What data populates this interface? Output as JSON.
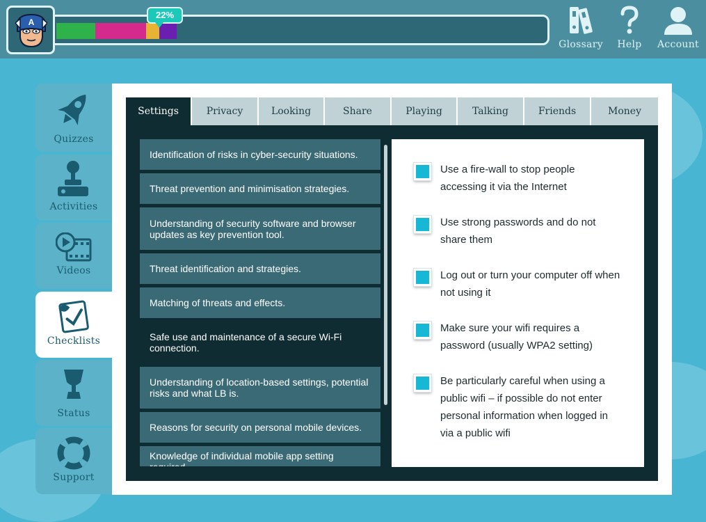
{
  "progress": {
    "percent_label": "22%",
    "value": 22,
    "segments": [
      {
        "color": "#2fb24a",
        "fraction": 0.079
      },
      {
        "color": "#d42a8b",
        "fraction": 0.103
      },
      {
        "color": "#e8b333",
        "fraction": 0.027
      },
      {
        "color": "#6a1fb0",
        "fraction": 0.036
      }
    ]
  },
  "avatar": {
    "icon": "captain-america-avatar"
  },
  "top_nav": [
    {
      "label": "Glossary",
      "icon": "books-icon"
    },
    {
      "label": "Help",
      "icon": "question-icon"
    },
    {
      "label": "Account",
      "icon": "user-icon"
    }
  ],
  "sidebar": {
    "items": [
      {
        "label": "Quizzes",
        "icon": "rocket-icon"
      },
      {
        "label": "Activities",
        "icon": "joystick-icon"
      },
      {
        "label": "Videos",
        "icon": "video-icon"
      },
      {
        "label": "Checklists",
        "icon": "checklist-icon",
        "active": true
      },
      {
        "label": "Status",
        "icon": "trophy-icon"
      },
      {
        "label": "Support",
        "icon": "lifebuoy-icon"
      }
    ]
  },
  "tabs": [
    {
      "label": "Settings",
      "active": true
    },
    {
      "label": "Privacy"
    },
    {
      "label": "Looking"
    },
    {
      "label": "Share"
    },
    {
      "label": "Playing"
    },
    {
      "label": "Talking"
    },
    {
      "label": "Friends"
    },
    {
      "label": "Money"
    }
  ],
  "topics": [
    {
      "text": "Identification of risks in cyber-security situations."
    },
    {
      "text": "Threat prevention and minimisation strategies."
    },
    {
      "text": "Understanding of security software and browser updates as key prevention tool."
    },
    {
      "text": "Threat identification and strategies."
    },
    {
      "text": "Matching of threats and effects."
    },
    {
      "text": "Safe use and maintenance of a secure Wi-Fi connection.",
      "selected": true
    },
    {
      "text": "Understanding of location-based settings, potential risks and what LB is."
    },
    {
      "text": "Reasons for security on personal mobile devices."
    },
    {
      "text": "Knowledge of individual mobile app setting required"
    }
  ],
  "checklist": [
    {
      "text": "Use a fire-wall to stop people accessing it via the Internet"
    },
    {
      "text": "Use strong passwords and do not share them"
    },
    {
      "text": "Log out or turn your computer off when not using it"
    },
    {
      "text": "Make sure your wifi requires a password (usually WPA2 setting)"
    },
    {
      "text": "Be particularly careful when using a public wifi – if possible do not enter personal information when logged in via a public wifi"
    }
  ],
  "colors": {
    "background": "#48b6d2",
    "topbar": "#4a8ea0",
    "content_dark": "#0f2c33",
    "list_item": "#3b6a77",
    "checkbox": "#17b7d6",
    "badge": "#1cc8b7"
  }
}
